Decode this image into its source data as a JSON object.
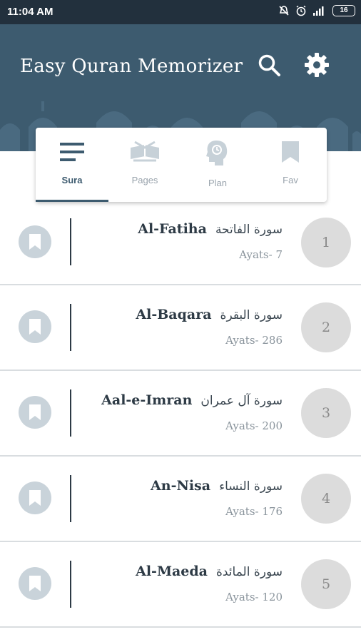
{
  "status_bar": {
    "time": "11:04 AM",
    "battery": "16"
  },
  "header": {
    "title": "Easy Quran Memorizer"
  },
  "tabs": [
    {
      "label": "Sura",
      "icon": "lines-icon",
      "active": true
    },
    {
      "label": "Pages",
      "icon": "open-quran-icon",
      "active": false
    },
    {
      "label": "Plan",
      "icon": "head-plan-icon",
      "active": false
    },
    {
      "label": "Fav",
      "icon": "bookmark-icon",
      "active": false
    }
  ],
  "suras": [
    {
      "number": "1",
      "name_en": "Al-Fatiha",
      "name_ar": "سورة الفاتحة",
      "ayats": "Ayats- 7"
    },
    {
      "number": "2",
      "name_en": "Al-Baqara",
      "name_ar": "سورة البقرة",
      "ayats": "Ayats- 286"
    },
    {
      "number": "3",
      "name_en": "Aal-e-Imran",
      "name_ar": "سورة آل عمران",
      "ayats": "Ayats- 200"
    },
    {
      "number": "4",
      "name_en": "An-Nisa",
      "name_ar": "سورة النساء",
      "ayats": "Ayats- 176"
    },
    {
      "number": "5",
      "name_en": "Al-Maeda",
      "name_ar": "سورة المائدة",
      "ayats": "Ayats- 120"
    }
  ],
  "colors": {
    "header": "#3d5b6f",
    "status_bar": "#22303d",
    "accent": "#3d5b6f"
  }
}
